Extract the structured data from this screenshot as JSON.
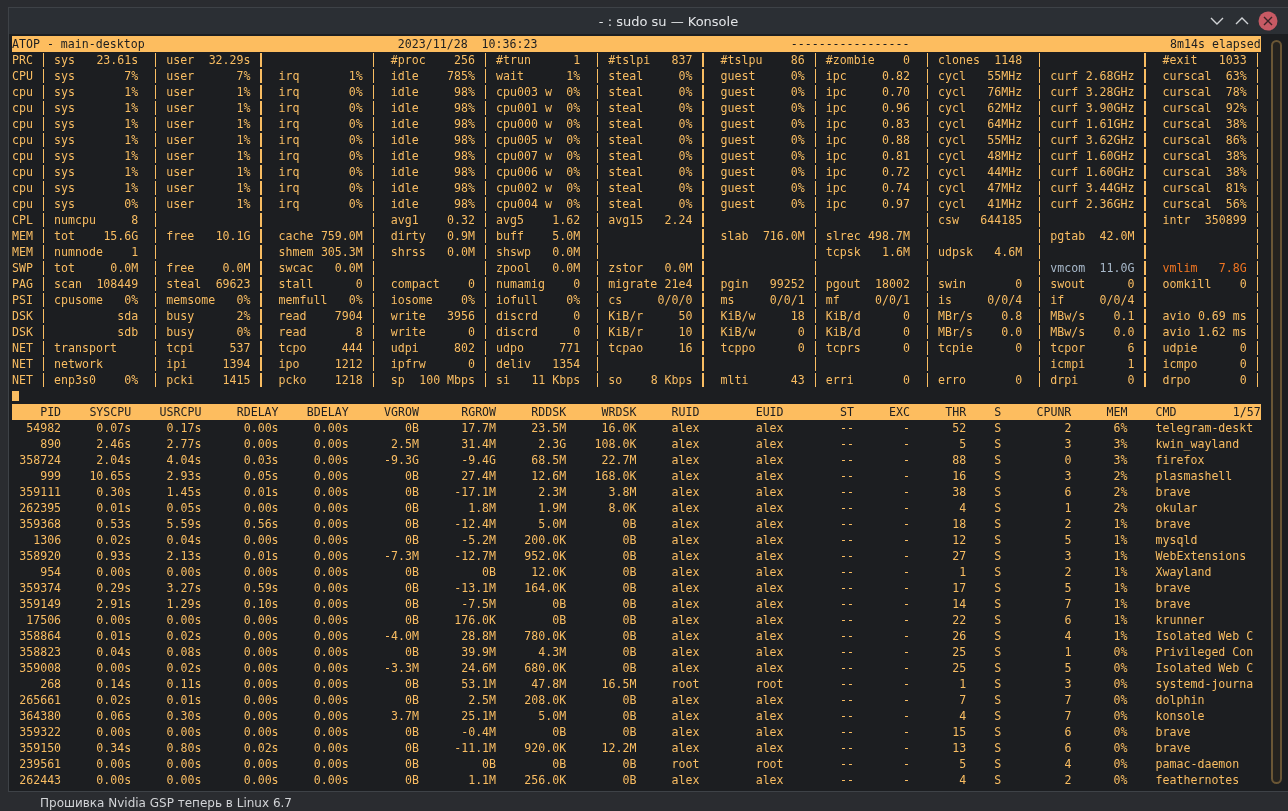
{
  "window": {
    "title": "- : sudo su — Konsole"
  },
  "header": {
    "title": "ATOP - main-desktop",
    "datetime": "2023/11/28  10:36:23",
    "flags": "-----------------",
    "elapsed": "8m14s elapsed"
  },
  "system": [
    {
      "label": "PRC",
      "fields": [
        {
          "kind": "stat",
          "name": "sys",
          "value": "23.61s"
        },
        {
          "kind": "stat",
          "name": "user",
          "value": "32.29s"
        },
        {
          "kind": "blank"
        },
        {
          "kind": "stat",
          "name": "#proc",
          "value": "256"
        },
        {
          "kind": "stat",
          "name": "#trun",
          "value": "1"
        },
        {
          "kind": "stat",
          "name": "#tslpi",
          "value": "837"
        },
        {
          "kind": "stat",
          "name": "#tslpu",
          "value": "86"
        },
        {
          "kind": "stat",
          "name": "#zombie",
          "value": "0"
        },
        {
          "kind": "stat",
          "name": "clones",
          "value": "1148"
        },
        {
          "kind": "blank"
        },
        {
          "kind": "stat",
          "name": "#exit",
          "value": "1033"
        }
      ]
    },
    {
      "label": "CPU",
      "fields": [
        {
          "kind": "stat",
          "name": "sys",
          "value": "7%"
        },
        {
          "kind": "stat",
          "name": "user",
          "value": "7%"
        },
        {
          "kind": "stat",
          "name": "irq",
          "value": "1%"
        },
        {
          "kind": "stat",
          "name": "idle",
          "value": "785%"
        },
        {
          "kind": "stat",
          "name": "wait",
          "value": "1%"
        },
        {
          "kind": "stat",
          "name": "steal",
          "value": "0%"
        },
        {
          "kind": "stat",
          "name": "guest",
          "value": "0%"
        },
        {
          "kind": "stat",
          "name": "ipc",
          "value": "0.82"
        },
        {
          "kind": "stat",
          "name": "cycl",
          "value": "55MHz"
        },
        {
          "kind": "stat",
          "name": "curf",
          "value": "2.68GHz"
        },
        {
          "kind": "stat",
          "name": "curscal",
          "value": "63%"
        }
      ]
    },
    {
      "label": "cpu",
      "fields": [
        {
          "kind": "stat",
          "name": "sys",
          "value": "1%"
        },
        {
          "kind": "stat",
          "name": "user",
          "value": "1%"
        },
        {
          "kind": "stat",
          "name": "irq",
          "value": "0%"
        },
        {
          "kind": "stat",
          "name": "idle",
          "value": "98%"
        },
        {
          "kind": "stat",
          "name": "cpu003 w",
          "value": "0%"
        },
        {
          "kind": "stat",
          "name": "steal",
          "value": "0%"
        },
        {
          "kind": "stat",
          "name": "guest",
          "value": "0%"
        },
        {
          "kind": "stat",
          "name": "ipc",
          "value": "0.70"
        },
        {
          "kind": "stat",
          "name": "cycl",
          "value": "76MHz"
        },
        {
          "kind": "stat",
          "name": "curf",
          "value": "3.28GHz"
        },
        {
          "kind": "stat",
          "name": "curscal",
          "value": "78%"
        }
      ]
    },
    {
      "label": "cpu",
      "fields": [
        {
          "kind": "stat",
          "name": "sys",
          "value": "1%"
        },
        {
          "kind": "stat",
          "name": "user",
          "value": "1%"
        },
        {
          "kind": "stat",
          "name": "irq",
          "value": "0%"
        },
        {
          "kind": "stat",
          "name": "idle",
          "value": "98%"
        },
        {
          "kind": "stat",
          "name": "cpu001 w",
          "value": "0%"
        },
        {
          "kind": "stat",
          "name": "steal",
          "value": "0%"
        },
        {
          "kind": "stat",
          "name": "guest",
          "value": "0%"
        },
        {
          "kind": "stat",
          "name": "ipc",
          "value": "0.96"
        },
        {
          "kind": "stat",
          "name": "cycl",
          "value": "62MHz"
        },
        {
          "kind": "stat",
          "name": "curf",
          "value": "3.90GHz"
        },
        {
          "kind": "stat",
          "name": "curscal",
          "value": "92%"
        }
      ]
    },
    {
      "label": "cpu",
      "fields": [
        {
          "kind": "stat",
          "name": "sys",
          "value": "1%"
        },
        {
          "kind": "stat",
          "name": "user",
          "value": "1%"
        },
        {
          "kind": "stat",
          "name": "irq",
          "value": "0%"
        },
        {
          "kind": "stat",
          "name": "idle",
          "value": "98%"
        },
        {
          "kind": "stat",
          "name": "cpu000 w",
          "value": "0%"
        },
        {
          "kind": "stat",
          "name": "steal",
          "value": "0%"
        },
        {
          "kind": "stat",
          "name": "guest",
          "value": "0%"
        },
        {
          "kind": "stat",
          "name": "ipc",
          "value": "0.83"
        },
        {
          "kind": "stat",
          "name": "cycl",
          "value": "64MHz"
        },
        {
          "kind": "stat",
          "name": "curf",
          "value": "1.61GHz"
        },
        {
          "kind": "stat",
          "name": "curscal",
          "value": "38%"
        }
      ]
    },
    {
      "label": "cpu",
      "fields": [
        {
          "kind": "stat",
          "name": "sys",
          "value": "1%"
        },
        {
          "kind": "stat",
          "name": "user",
          "value": "1%"
        },
        {
          "kind": "stat",
          "name": "irq",
          "value": "0%"
        },
        {
          "kind": "stat",
          "name": "idle",
          "value": "98%"
        },
        {
          "kind": "stat",
          "name": "cpu005 w",
          "value": "0%"
        },
        {
          "kind": "stat",
          "name": "steal",
          "value": "0%"
        },
        {
          "kind": "stat",
          "name": "guest",
          "value": "0%"
        },
        {
          "kind": "stat",
          "name": "ipc",
          "value": "0.88"
        },
        {
          "kind": "stat",
          "name": "cycl",
          "value": "55MHz"
        },
        {
          "kind": "stat",
          "name": "curf",
          "value": "3.62GHz"
        },
        {
          "kind": "stat",
          "name": "curscal",
          "value": "86%"
        }
      ]
    },
    {
      "label": "cpu",
      "fields": [
        {
          "kind": "stat",
          "name": "sys",
          "value": "1%"
        },
        {
          "kind": "stat",
          "name": "user",
          "value": "1%"
        },
        {
          "kind": "stat",
          "name": "irq",
          "value": "0%"
        },
        {
          "kind": "stat",
          "name": "idle",
          "value": "98%"
        },
        {
          "kind": "stat",
          "name": "cpu007 w",
          "value": "0%"
        },
        {
          "kind": "stat",
          "name": "steal",
          "value": "0%"
        },
        {
          "kind": "stat",
          "name": "guest",
          "value": "0%"
        },
        {
          "kind": "stat",
          "name": "ipc",
          "value": "0.81"
        },
        {
          "kind": "stat",
          "name": "cycl",
          "value": "48MHz"
        },
        {
          "kind": "stat",
          "name": "curf",
          "value": "1.60GHz"
        },
        {
          "kind": "stat",
          "name": "curscal",
          "value": "38%"
        }
      ]
    },
    {
      "label": "cpu",
      "fields": [
        {
          "kind": "stat",
          "name": "sys",
          "value": "1%"
        },
        {
          "kind": "stat",
          "name": "user",
          "value": "1%"
        },
        {
          "kind": "stat",
          "name": "irq",
          "value": "0%"
        },
        {
          "kind": "stat",
          "name": "idle",
          "value": "98%"
        },
        {
          "kind": "stat",
          "name": "cpu006 w",
          "value": "0%"
        },
        {
          "kind": "stat",
          "name": "steal",
          "value": "0%"
        },
        {
          "kind": "stat",
          "name": "guest",
          "value": "0%"
        },
        {
          "kind": "stat",
          "name": "ipc",
          "value": "0.72"
        },
        {
          "kind": "stat",
          "name": "cycl",
          "value": "44MHz"
        },
        {
          "kind": "stat",
          "name": "curf",
          "value": "1.60GHz"
        },
        {
          "kind": "stat",
          "name": "curscal",
          "value": "38%"
        }
      ]
    },
    {
      "label": "cpu",
      "fields": [
        {
          "kind": "stat",
          "name": "sys",
          "value": "1%"
        },
        {
          "kind": "stat",
          "name": "user",
          "value": "1%"
        },
        {
          "kind": "stat",
          "name": "irq",
          "value": "0%"
        },
        {
          "kind": "stat",
          "name": "idle",
          "value": "98%"
        },
        {
          "kind": "stat",
          "name": "cpu002 w",
          "value": "0%"
        },
        {
          "kind": "stat",
          "name": "steal",
          "value": "0%"
        },
        {
          "kind": "stat",
          "name": "guest",
          "value": "0%"
        },
        {
          "kind": "stat",
          "name": "ipc",
          "value": "0.74"
        },
        {
          "kind": "stat",
          "name": "cycl",
          "value": "47MHz"
        },
        {
          "kind": "stat",
          "name": "curf",
          "value": "3.44GHz"
        },
        {
          "kind": "stat",
          "name": "curscal",
          "value": "81%"
        }
      ]
    },
    {
      "label": "cpu",
      "fields": [
        {
          "kind": "stat",
          "name": "sys",
          "value": "0%"
        },
        {
          "kind": "stat",
          "name": "user",
          "value": "1%"
        },
        {
          "kind": "stat",
          "name": "irq",
          "value": "0%"
        },
        {
          "kind": "stat",
          "name": "idle",
          "value": "98%"
        },
        {
          "kind": "stat",
          "name": "cpu004 w",
          "value": "0%"
        },
        {
          "kind": "stat",
          "name": "steal",
          "value": "0%"
        },
        {
          "kind": "stat",
          "name": "guest",
          "value": "0%"
        },
        {
          "kind": "stat",
          "name": "ipc",
          "value": "0.97"
        },
        {
          "kind": "stat",
          "name": "cycl",
          "value": "41MHz"
        },
        {
          "kind": "stat",
          "name": "curf",
          "value": "2.36GHz"
        },
        {
          "kind": "stat",
          "name": "curscal",
          "value": "56%"
        }
      ]
    },
    {
      "label": "CPL",
      "fields": [
        {
          "kind": "stat",
          "name": "numcpu",
          "value": "8"
        },
        {
          "kind": "blank"
        },
        {
          "kind": "blank"
        },
        {
          "kind": "stat",
          "name": "avg1",
          "value": "0.32"
        },
        {
          "kind": "stat",
          "name": "avg5",
          "value": "1.62"
        },
        {
          "kind": "stat",
          "name": "avg15",
          "value": "2.24"
        },
        {
          "kind": "blank"
        },
        {
          "kind": "blank"
        },
        {
          "kind": "stat",
          "name": "csw",
          "value": "644185"
        },
        {
          "kind": "blank"
        },
        {
          "kind": "stat",
          "name": "intr",
          "value": "350899"
        }
      ]
    },
    {
      "label": "MEM",
      "fields": [
        {
          "kind": "stat",
          "name": "tot",
          "value": "15.6G"
        },
        {
          "kind": "stat",
          "name": "free",
          "value": "10.1G"
        },
        {
          "kind": "stat",
          "name": "cache",
          "value": "759.0M"
        },
        {
          "kind": "stat",
          "name": "dirty",
          "value": "0.9M"
        },
        {
          "kind": "stat",
          "name": "buff",
          "value": "5.0M"
        },
        {
          "kind": "blank"
        },
        {
          "kind": "stat",
          "name": "slab",
          "value": "716.0M"
        },
        {
          "kind": "stat",
          "name": "slrec",
          "value": "498.7M"
        },
        {
          "kind": "blank"
        },
        {
          "kind": "stat",
          "name": "pgtab",
          "value": "42.0M"
        }
      ]
    },
    {
      "label": "MEM",
      "fields": [
        {
          "kind": "stat",
          "name": "numnode",
          "value": "1"
        },
        {
          "kind": "blank"
        },
        {
          "kind": "stat",
          "name": "shmem",
          "value": "305.3M"
        },
        {
          "kind": "stat",
          "name": "shrss",
          "value": "0.0M"
        },
        {
          "kind": "stat",
          "name": "shswp",
          "value": "0.0M"
        },
        {
          "kind": "blank"
        },
        {
          "kind": "blank"
        },
        {
          "kind": "stat",
          "name": "tcpsk",
          "value": "1.6M"
        },
        {
          "kind": "stat",
          "name": "udpsk",
          "value": "4.6M"
        }
      ]
    },
    {
      "label": "SWP",
      "fields": [
        {
          "kind": "stat",
          "name": "tot",
          "value": "0.0M"
        },
        {
          "kind": "stat",
          "name": "free",
          "value": "0.0M"
        },
        {
          "kind": "stat",
          "name": "swcac",
          "value": "0.0M"
        },
        {
          "kind": "blank"
        },
        {
          "kind": "stat",
          "name": "zpool",
          "value": "0.0M"
        },
        {
          "kind": "stat",
          "name": "zstor",
          "value": "0.0M"
        },
        {
          "kind": "blank"
        },
        {
          "kind": "blank"
        },
        {
          "kind": "blank"
        },
        {
          "kind": "stat",
          "name": "vmcom",
          "value": "11.0G",
          "color": "#a9bacb"
        },
        {
          "kind": "stat",
          "name": "vmlim",
          "value": "7.8G",
          "color": "#f07522"
        }
      ]
    },
    {
      "label": "PAG",
      "fields": [
        {
          "kind": "stat",
          "name": "scan",
          "value": "108449"
        },
        {
          "kind": "stat",
          "name": "steal",
          "value": "69623"
        },
        {
          "kind": "stat",
          "name": "stall",
          "value": "0"
        },
        {
          "kind": "stat",
          "name": "compact",
          "value": "0"
        },
        {
          "kind": "stat",
          "name": "numamig",
          "value": "0"
        },
        {
          "kind": "stat",
          "name": "migrate",
          "value": "21e4"
        },
        {
          "kind": "stat",
          "name": "pgin",
          "value": "99252"
        },
        {
          "kind": "stat",
          "name": "pgout",
          "value": "18002"
        },
        {
          "kind": "stat",
          "name": "swin",
          "value": "0"
        },
        {
          "kind": "stat",
          "name": "swout",
          "value": "0"
        },
        {
          "kind": "stat",
          "name": "oomkill",
          "value": "0"
        }
      ]
    },
    {
      "label": "PSI",
      "fields": [
        {
          "kind": "stat",
          "name": "cpusome",
          "value": "0%"
        },
        {
          "kind": "stat",
          "name": "memsome",
          "value": "0%"
        },
        {
          "kind": "stat",
          "name": "memfull",
          "value": "0%"
        },
        {
          "kind": "stat",
          "name": "iosome",
          "value": "0%"
        },
        {
          "kind": "stat",
          "name": "iofull",
          "value": "0%"
        },
        {
          "kind": "stat",
          "name": "cs",
          "value": "0/0/0"
        },
        {
          "kind": "stat",
          "name": "ms",
          "value": "0/0/1"
        },
        {
          "kind": "stat",
          "name": "mf",
          "value": "0/0/1"
        },
        {
          "kind": "stat",
          "name": "is",
          "value": "0/0/4"
        },
        {
          "kind": "stat",
          "name": "if",
          "value": "0/0/4"
        }
      ]
    },
    {
      "label": "DSK",
      "fields": [
        {
          "kind": "stat",
          "value": "sda"
        },
        {
          "kind": "stat",
          "name": "busy",
          "value": "2%"
        },
        {
          "kind": "stat",
          "name": "read",
          "value": "7904"
        },
        {
          "kind": "stat",
          "name": "write",
          "value": "3956"
        },
        {
          "kind": "stat",
          "name": "discrd",
          "value": "0"
        },
        {
          "kind": "stat",
          "name": "KiB/r",
          "value": "50"
        },
        {
          "kind": "stat",
          "name": "KiB/w",
          "value": "18"
        },
        {
          "kind": "stat",
          "name": "KiB/d",
          "value": "0"
        },
        {
          "kind": "stat",
          "name": "MBr/s",
          "value": "0.8"
        },
        {
          "kind": "stat",
          "name": "MBw/s",
          "value": "0.1"
        },
        {
          "kind": "stat",
          "name": "avio",
          "value": "0.69 ms"
        }
      ]
    },
    {
      "label": "DSK",
      "fields": [
        {
          "kind": "stat",
          "value": "sdb"
        },
        {
          "kind": "stat",
          "name": "busy",
          "value": "0%"
        },
        {
          "kind": "stat",
          "name": "read",
          "value": "8"
        },
        {
          "kind": "stat",
          "name": "write",
          "value": "0"
        },
        {
          "kind": "stat",
          "name": "discrd",
          "value": "0"
        },
        {
          "kind": "stat",
          "name": "KiB/r",
          "value": "10"
        },
        {
          "kind": "stat",
          "name": "KiB/w",
          "value": "0"
        },
        {
          "kind": "stat",
          "name": "KiB/d",
          "value": "0"
        },
        {
          "kind": "stat",
          "name": "MBr/s",
          "value": "0.0"
        },
        {
          "kind": "stat",
          "name": "MBw/s",
          "value": "0.0"
        },
        {
          "kind": "stat",
          "name": "avio",
          "value": "1.62 ms"
        }
      ]
    },
    {
      "label": "NET",
      "fields": [
        {
          "kind": "stat",
          "name": "transport"
        },
        {
          "kind": "stat",
          "name": "tcpi",
          "value": "537"
        },
        {
          "kind": "stat",
          "name": "tcpo",
          "value": "444"
        },
        {
          "kind": "stat",
          "name": "udpi",
          "value": "802"
        },
        {
          "kind": "stat",
          "name": "udpo",
          "value": "771"
        },
        {
          "kind": "stat",
          "name": "tcpao",
          "value": "16"
        },
        {
          "kind": "stat",
          "name": "tcppo",
          "value": "0"
        },
        {
          "kind": "stat",
          "name": "tcprs",
          "value": "0"
        },
        {
          "kind": "stat",
          "name": "tcpie",
          "value": "0"
        },
        {
          "kind": "stat",
          "name": "tcpor",
          "value": "6"
        },
        {
          "kind": "stat",
          "name": "udpie",
          "value": "0"
        }
      ]
    },
    {
      "label": "NET",
      "fields": [
        {
          "kind": "stat",
          "name": "network"
        },
        {
          "kind": "stat",
          "name": "ipi",
          "value": "1394"
        },
        {
          "kind": "stat",
          "name": "ipo",
          "value": "1212"
        },
        {
          "kind": "stat",
          "name": "ipfrw",
          "value": "0"
        },
        {
          "kind": "stat",
          "name": "deliv",
          "value": "1354"
        },
        {
          "kind": "blank"
        },
        {
          "kind": "blank"
        },
        {
          "kind": "blank"
        },
        {
          "kind": "blank"
        },
        {
          "kind": "stat",
          "name": "icmpi",
          "value": "1"
        },
        {
          "kind": "stat",
          "name": "icmpo",
          "value": "0"
        }
      ]
    },
    {
      "label": "NET",
      "fields": [
        {
          "kind": "stat",
          "name": "enp3s0",
          "value": "0%"
        },
        {
          "kind": "stat",
          "name": "pcki",
          "value": "1415"
        },
        {
          "kind": "stat",
          "name": "pcko",
          "value": "1218"
        },
        {
          "kind": "stat",
          "name": "sp",
          "value": "100 Mbps"
        },
        {
          "kind": "stat",
          "name": "si",
          "value": "11 Kbps"
        },
        {
          "kind": "stat",
          "name": "so",
          "value": "8 Kbps"
        },
        {
          "kind": "stat",
          "name": "mlti",
          "value": "43"
        },
        {
          "kind": "stat",
          "name": "erri",
          "value": "0"
        },
        {
          "kind": "stat",
          "name": "erro",
          "value": "0"
        },
        {
          "kind": "stat",
          "name": "drpi",
          "value": "0"
        },
        {
          "kind": "stat",
          "name": "drpo",
          "value": "0"
        }
      ]
    }
  ],
  "process_table": {
    "columns": [
      "PID",
      "SYSCPU",
      "USRCPU",
      "RDELAY",
      "BDELAY",
      "VGROW",
      "RGROW",
      "RDDSK",
      "WRDSK",
      "RUID",
      "EUID",
      "ST",
      "EXC",
      "THR",
      "S",
      "CPUNR",
      "MEM",
      "CMD"
    ],
    "position": "1/57",
    "rows": [
      [
        "54982",
        "0.07s",
        "0.17s",
        "0.00s",
        "0.00s",
        "0B",
        "17.7M",
        "23.5M",
        "16.0K",
        "alex",
        "alex",
        "--",
        "-",
        "52",
        "S",
        "2",
        "6%",
        "telegram-deskt"
      ],
      [
        "890",
        "2.46s",
        "2.77s",
        "0.00s",
        "0.00s",
        "2.5M",
        "31.4M",
        "2.3G",
        "108.0K",
        "alex",
        "alex",
        "--",
        "-",
        "5",
        "S",
        "3",
        "3%",
        "kwin_wayland"
      ],
      [
        "358724",
        "2.04s",
        "4.04s",
        "0.03s",
        "0.00s",
        "-9.3G",
        "-9.4G",
        "68.5M",
        "22.7M",
        "alex",
        "alex",
        "--",
        "-",
        "88",
        "S",
        "0",
        "3%",
        "firefox"
      ],
      [
        "999",
        "10.65s",
        "2.93s",
        "0.05s",
        "0.00s",
        "0B",
        "27.4M",
        "12.6M",
        "168.0K",
        "alex",
        "alex",
        "--",
        "-",
        "16",
        "S",
        "3",
        "2%",
        "plasmashell"
      ],
      [
        "359111",
        "0.30s",
        "1.45s",
        "0.01s",
        "0.00s",
        "0B",
        "-17.1M",
        "2.3M",
        "3.8M",
        "alex",
        "alex",
        "--",
        "-",
        "38",
        "S",
        "6",
        "2%",
        "brave"
      ],
      [
        "262395",
        "0.01s",
        "0.05s",
        "0.00s",
        "0.00s",
        "0B",
        "1.8M",
        "1.9M",
        "8.0K",
        "alex",
        "alex",
        "--",
        "-",
        "4",
        "S",
        "1",
        "2%",
        "okular"
      ],
      [
        "359368",
        "0.53s",
        "5.59s",
        "0.56s",
        "0.00s",
        "0B",
        "-12.4M",
        "5.0M",
        "0B",
        "alex",
        "alex",
        "--",
        "-",
        "18",
        "S",
        "2",
        "1%",
        "brave"
      ],
      [
        "1306",
        "0.02s",
        "0.04s",
        "0.00s",
        "0.00s",
        "0B",
        "-5.2M",
        "200.0K",
        "0B",
        "alex",
        "alex",
        "--",
        "-",
        "12",
        "S",
        "5",
        "1%",
        "mysqld"
      ],
      [
        "358920",
        "0.93s",
        "2.13s",
        "0.01s",
        "0.00s",
        "-7.3M",
        "-12.7M",
        "952.0K",
        "0B",
        "alex",
        "alex",
        "--",
        "-",
        "27",
        "S",
        "3",
        "1%",
        "WebExtensions"
      ],
      [
        "954",
        "0.00s",
        "0.00s",
        "0.00s",
        "0.00s",
        "0B",
        "0B",
        "12.0K",
        "0B",
        "alex",
        "alex",
        "--",
        "-",
        "1",
        "S",
        "2",
        "1%",
        "Xwayland"
      ],
      [
        "359374",
        "0.29s",
        "3.27s",
        "0.59s",
        "0.00s",
        "0B",
        "-13.1M",
        "164.0K",
        "0B",
        "alex",
        "alex",
        "--",
        "-",
        "17",
        "S",
        "5",
        "1%",
        "brave"
      ],
      [
        "359149",
        "2.91s",
        "1.29s",
        "0.10s",
        "0.00s",
        "0B",
        "-7.5M",
        "0B",
        "0B",
        "alex",
        "alex",
        "--",
        "-",
        "14",
        "S",
        "7",
        "1%",
        "brave"
      ],
      [
        "17506",
        "0.00s",
        "0.00s",
        "0.00s",
        "0.00s",
        "0B",
        "176.0K",
        "0B",
        "0B",
        "alex",
        "alex",
        "--",
        "-",
        "22",
        "S",
        "6",
        "1%",
        "krunner"
      ],
      [
        "358864",
        "0.01s",
        "0.02s",
        "0.00s",
        "0.00s",
        "-4.0M",
        "28.8M",
        "780.0K",
        "0B",
        "alex",
        "alex",
        "--",
        "-",
        "26",
        "S",
        "4",
        "1%",
        "Isolated Web C"
      ],
      [
        "358823",
        "0.04s",
        "0.08s",
        "0.00s",
        "0.00s",
        "0B",
        "39.9M",
        "4.3M",
        "0B",
        "alex",
        "alex",
        "--",
        "-",
        "25",
        "S",
        "1",
        "0%",
        "Privileged Con"
      ],
      [
        "359008",
        "0.00s",
        "0.02s",
        "0.00s",
        "0.00s",
        "-3.3M",
        "24.6M",
        "680.0K",
        "0B",
        "alex",
        "alex",
        "--",
        "-",
        "25",
        "S",
        "5",
        "0%",
        "Isolated Web C"
      ],
      [
        "268",
        "0.14s",
        "0.11s",
        "0.00s",
        "0.00s",
        "0B",
        "53.1M",
        "47.8M",
        "16.5M",
        "root",
        "root",
        "--",
        "-",
        "1",
        "S",
        "3",
        "0%",
        "systemd-journa"
      ],
      [
        "265661",
        "0.02s",
        "0.01s",
        "0.00s",
        "0.00s",
        "0B",
        "2.5M",
        "208.0K",
        "0B",
        "alex",
        "alex",
        "--",
        "-",
        "7",
        "S",
        "7",
        "0%",
        "dolphin"
      ],
      [
        "364380",
        "0.06s",
        "0.30s",
        "0.00s",
        "0.00s",
        "3.7M",
        "25.1M",
        "5.0M",
        "0B",
        "alex",
        "alex",
        "--",
        "-",
        "4",
        "S",
        "7",
        "0%",
        "konsole"
      ],
      [
        "359322",
        "0.00s",
        "0.00s",
        "0.00s",
        "0.00s",
        "0B",
        "-0.4M",
        "0B",
        "0B",
        "alex",
        "alex",
        "--",
        "-",
        "15",
        "S",
        "6",
        "0%",
        "brave"
      ],
      [
        "359150",
        "0.34s",
        "0.80s",
        "0.02s",
        "0.00s",
        "0B",
        "-11.1M",
        "920.0K",
        "12.2M",
        "alex",
        "alex",
        "--",
        "-",
        "13",
        "S",
        "6",
        "0%",
        "brave"
      ],
      [
        "239561",
        "0.00s",
        "0.00s",
        "0.00s",
        "0.00s",
        "0B",
        "0B",
        "0B",
        "0B",
        "root",
        "root",
        "--",
        "-",
        "5",
        "S",
        "4",
        "0%",
        "pamac-daemon"
      ],
      [
        "262443",
        "0.00s",
        "0.00s",
        "0.00s",
        "0.00s",
        "0B",
        "1.1M",
        "256.0K",
        "0B",
        "alex",
        "alex",
        "--",
        "-",
        "4",
        "S",
        "2",
        "0%",
        "feathernotes"
      ]
    ]
  },
  "background_text": "Прошивка Nvidia GSP теперь в Linux 6.7"
}
